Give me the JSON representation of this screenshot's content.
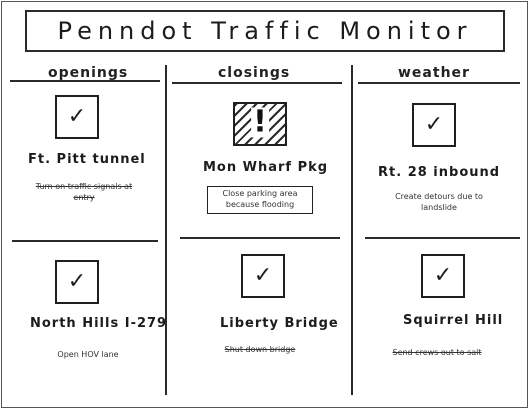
{
  "app": {
    "title": "Penndot Traffic Monitor"
  },
  "columns": [
    {
      "header": "openings"
    },
    {
      "header": "closings"
    },
    {
      "header": "weather"
    }
  ],
  "cards": [
    {
      "label": "Ft. Pitt tunnel",
      "note": "Turn on traffic signals at entry",
      "checked": true
    },
    {
      "label": "Mon Wharf Pkg",
      "note": "Close parking area because flooding",
      "checked": false,
      "icon": "warning-hatched-icon"
    },
    {
      "label": "Rt. 28 inbound",
      "note": "Create detours due to landslide",
      "checked": true
    },
    {
      "label": "North Hills I-279",
      "note": "Open HOV lane",
      "checked": true
    },
    {
      "label": "Liberty Bridge",
      "note": "Shut down bridge",
      "checked": true
    },
    {
      "label": "Squirrel Hill",
      "note": "Send crews out to salt",
      "checked": true
    }
  ],
  "icons": {
    "check": "✓"
  }
}
